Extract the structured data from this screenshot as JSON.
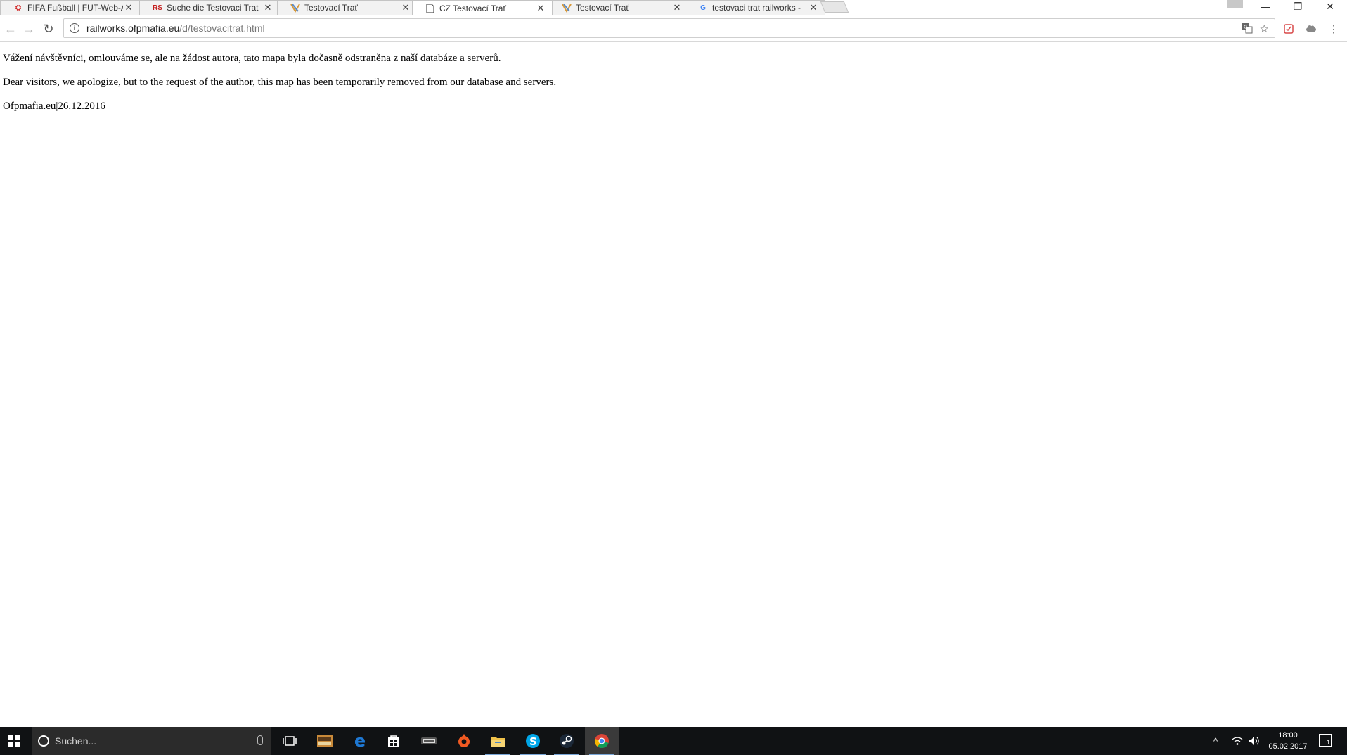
{
  "browser": {
    "tabs": [
      {
        "title": "FIFA Fußball | FUT-Web-A",
        "favicon": "ea-icon",
        "active": false
      },
      {
        "title": "Suche die Testovaci Trat",
        "favicon": "rs-icon",
        "active": false
      },
      {
        "title": "Testovací Trať",
        "favicon": "site-icon",
        "active": false
      },
      {
        "title": "CZ Testovací Trať",
        "favicon": "page-icon",
        "active": true
      },
      {
        "title": "Testovací Trať",
        "favicon": "site-icon",
        "active": false
      },
      {
        "title": "testovaci trat railworks -",
        "favicon": "google-icon",
        "active": false
      }
    ],
    "rs_favicon_text": "RS",
    "google_favicon_text": "G",
    "url_host": "railworks.ofpmafia.eu",
    "url_path": "/d/testovacitrat.html"
  },
  "page": {
    "line_cz": "Vážení návštěvníci, omlouváme se, ale na žádost autora, tato mapa byla dočasně odstraněna z naší databáze a serverů.",
    "line_en": "Dear visitors, we apologize, but to the request of the author, this map has been temporarily removed from our database and servers.",
    "footer": "Ofpmafia.eu|26.12.2016"
  },
  "taskbar": {
    "search_placeholder": "Suchen...",
    "time": "18:00",
    "date": "05.02.2017",
    "notification_count": "1"
  },
  "colors": {
    "taskbar_bg": "#101214",
    "ea_red": "#d22828",
    "rs_red": "#c41e1e",
    "edge_blue": "#1e78d4",
    "skype_blue": "#00a6e8",
    "origin_orange": "#f15a22",
    "explorer_yellow": "#f0c24a"
  }
}
